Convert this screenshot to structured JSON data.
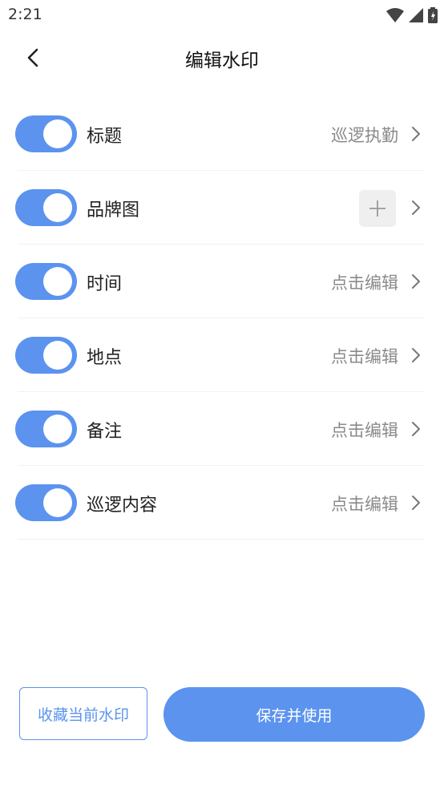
{
  "status_bar": {
    "time": "2:21"
  },
  "header": {
    "title": "编辑水印"
  },
  "rows": [
    {
      "label": "标题",
      "value": "巡逻执勤",
      "enabled": true
    },
    {
      "label": "品牌图",
      "enabled": true
    },
    {
      "label": "时间",
      "value": "点击编辑",
      "enabled": true
    },
    {
      "label": "地点",
      "value": "点击编辑",
      "enabled": true
    },
    {
      "label": "备注",
      "value": "点击编辑",
      "enabled": true
    },
    {
      "label": "巡逻内容",
      "value": "点击编辑",
      "enabled": true
    }
  ],
  "footer": {
    "favorite_label": "收藏当前水印",
    "save_label": "保存并使用"
  },
  "colors": {
    "accent": "#5b93ef",
    "value_text": "#8a8a8a",
    "divider": "#f1f2f4"
  },
  "icons": [
    "back-chevron-icon",
    "wifi-icon",
    "signal-icon",
    "battery-icon",
    "chevron-right-icon",
    "plus-icon"
  ]
}
